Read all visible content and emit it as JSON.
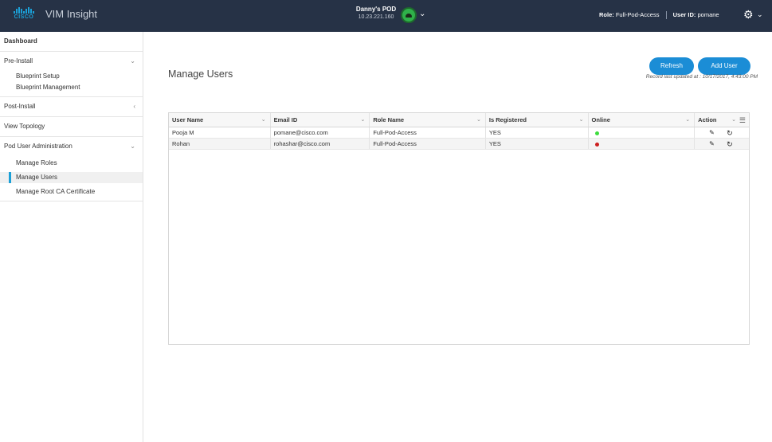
{
  "header": {
    "brand_word": "CISCO",
    "app_title": "VIM Insight",
    "pod_name": "Danny's POD",
    "pod_ip": "10.23.221.160",
    "role_label": "Role:",
    "role_value": "Full-Pod-Access",
    "user_label": "User ID:",
    "user_value": "pomane",
    "icons": {
      "settings": "gear-icon",
      "pod_status": "cloud-status-icon",
      "chevron": "chevron-down-icon"
    },
    "colors": {
      "bar": "#263246",
      "pod_status": "#2fb14a"
    }
  },
  "sidebar": {
    "dashboard": "Dashboard",
    "pre_install": "Pre-Install",
    "blueprint_setup": "Blueprint Setup",
    "blueprint_management": "Blueprint Management",
    "post_install": "Post-Install",
    "view_topology": "View Topology",
    "pod_user_admin": "Pod User Administration",
    "manage_roles": "Manage Roles",
    "manage_users": "Manage Users",
    "manage_root_ca": "Manage Root CA Certificate",
    "active_item": "Manage Users",
    "accent": "#1ba0d7"
  },
  "main": {
    "title": "Manage Users",
    "refresh_label": "Refresh",
    "add_user_label": "Add User",
    "updated_text": "Record last updated at : 10/17/2017, 4:43:00 PM",
    "button_color": "#1b8dd6"
  },
  "table": {
    "columns": [
      "User Name",
      "Email ID",
      "Role Name",
      "Is Registered",
      "Online",
      "Action"
    ],
    "rows": [
      {
        "user": "Pooja M",
        "email": "pomane@cisco.com",
        "role": "Full-Pod-Access",
        "registered": "YES",
        "online": "green"
      },
      {
        "user": "Rohan",
        "email": "rohashar@cisco.com",
        "role": "Full-Pod-Access",
        "registered": "YES",
        "online": "red"
      }
    ],
    "status_colors": {
      "green": "#3ddc3d",
      "red": "#cc1f1f"
    }
  }
}
